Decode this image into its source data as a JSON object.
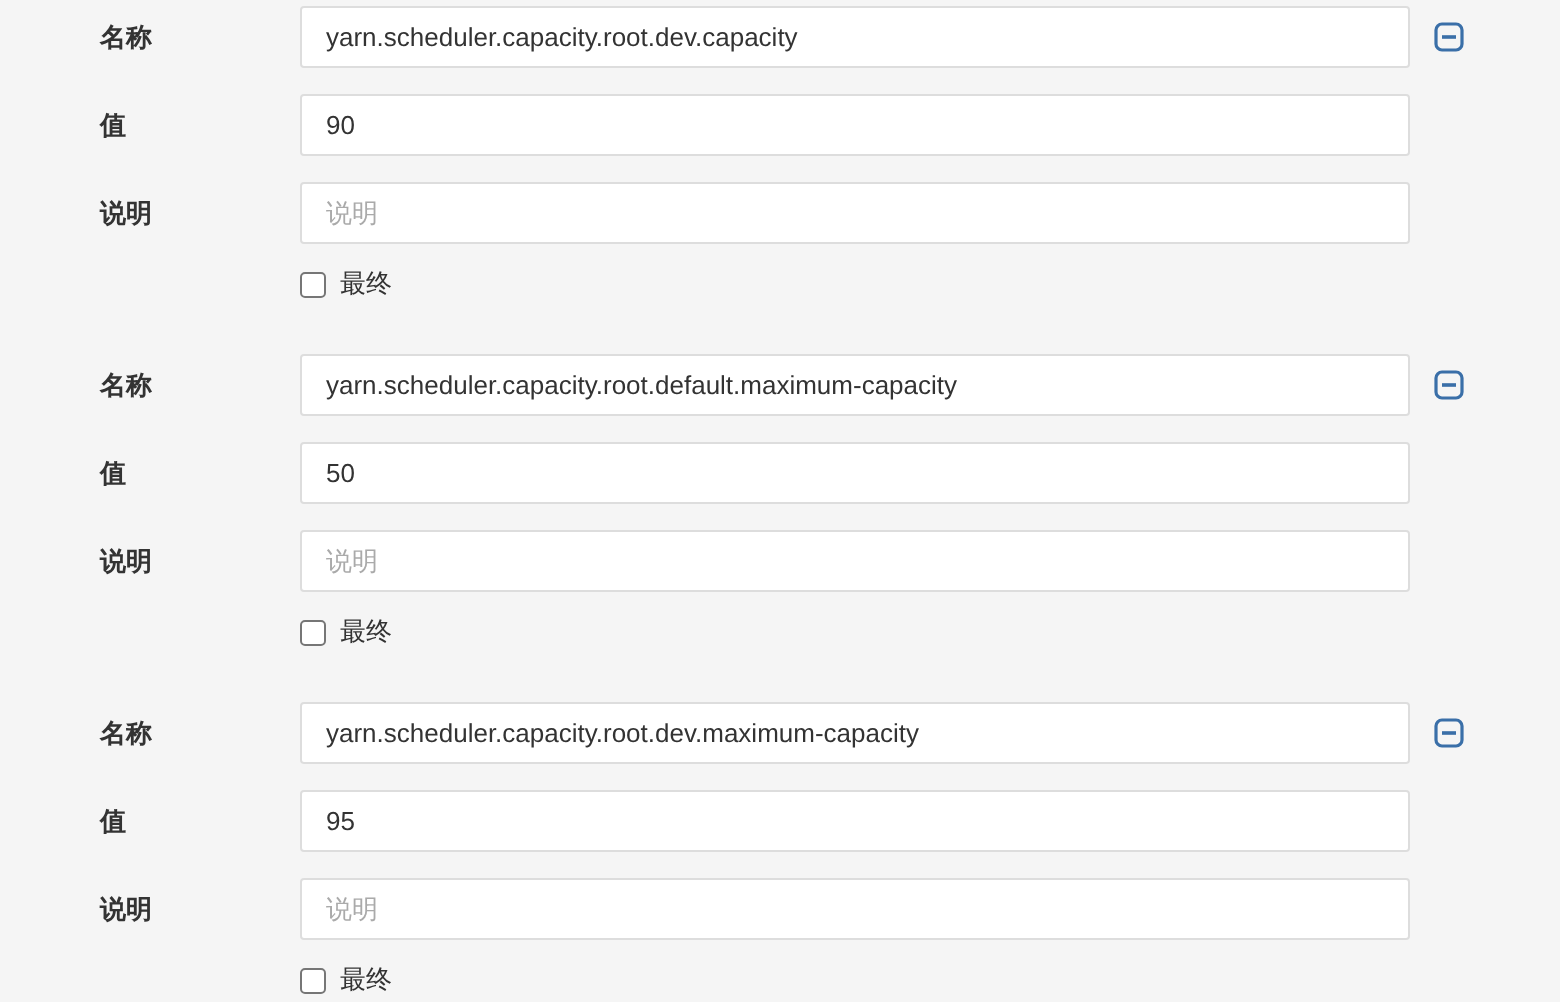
{
  "properties": [
    {
      "fields": [
        {
          "label": "名称",
          "value": "yarn.scheduler.capacity.root.dev.capacity"
        },
        {
          "label": "值",
          "value": "90"
        },
        {
          "label": "说明",
          "placeholder": "说明"
        }
      ],
      "final": {
        "label": "最终",
        "checked": false
      }
    },
    {
      "fields": [
        {
          "label": "名称",
          "value": "yarn.scheduler.capacity.root.default.maximum-capacity"
        },
        {
          "label": "值",
          "value": "50"
        },
        {
          "label": "说明",
          "placeholder": "说明"
        }
      ],
      "final": {
        "label": "最终",
        "checked": false
      }
    },
    {
      "fields": [
        {
          "label": "名称",
          "value": "yarn.scheduler.capacity.root.dev.maximum-capacity"
        },
        {
          "label": "值",
          "value": "95"
        },
        {
          "label": "说明",
          "placeholder": "说明"
        }
      ],
      "final": {
        "label": "最终",
        "checked": false
      }
    }
  ]
}
